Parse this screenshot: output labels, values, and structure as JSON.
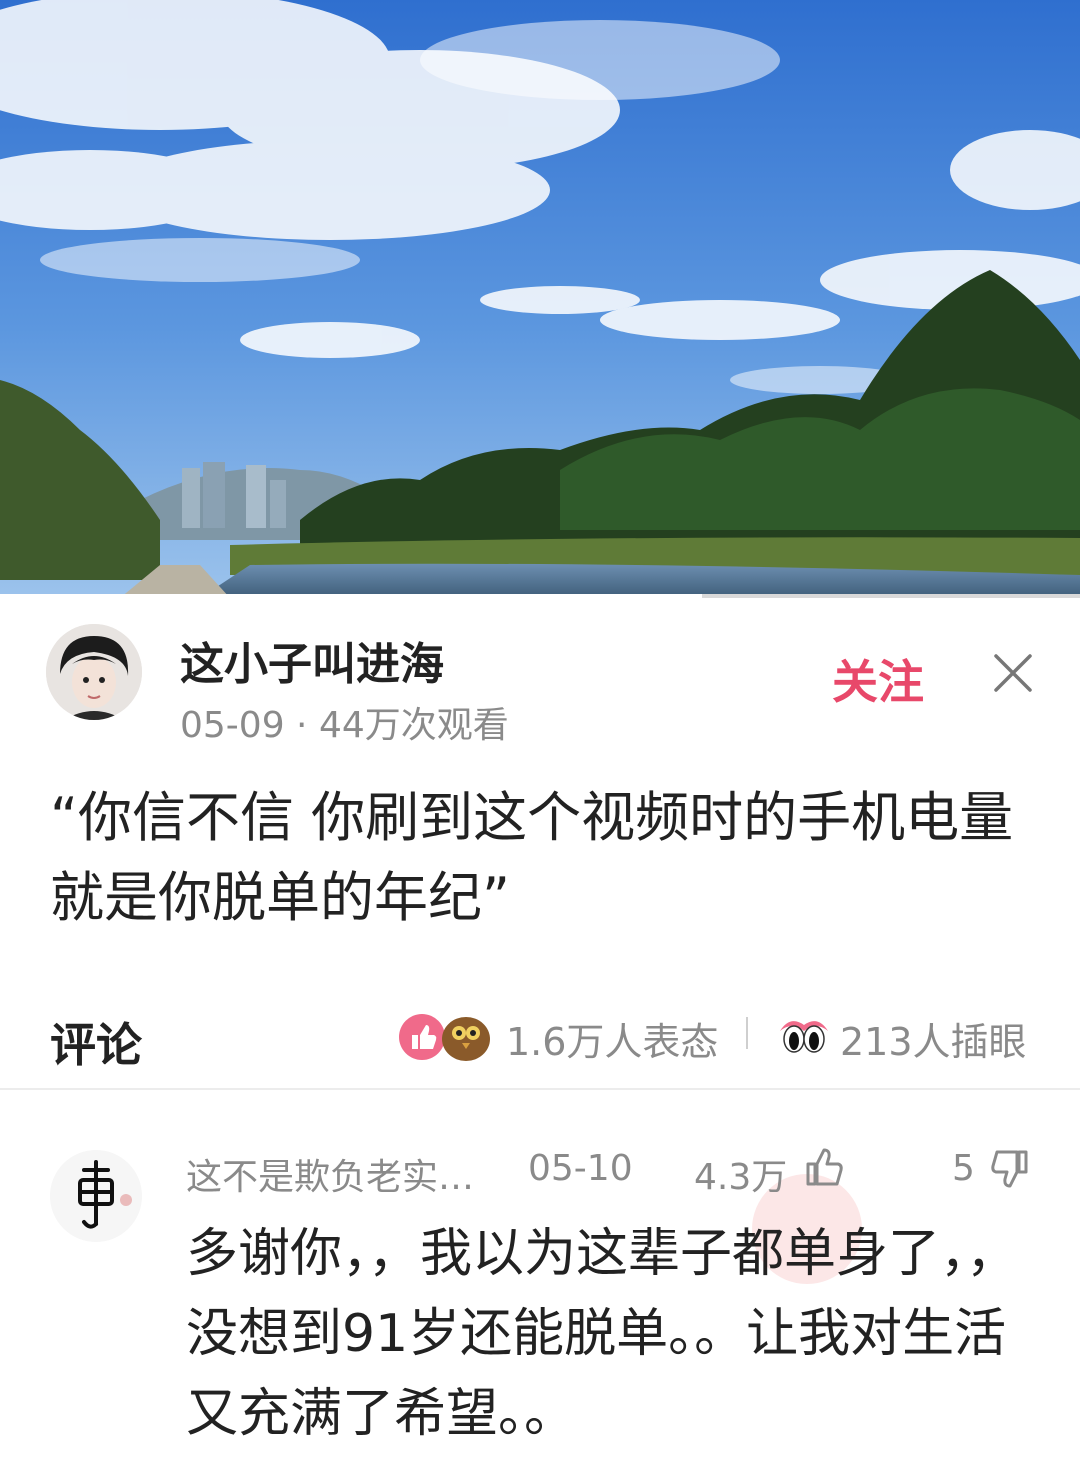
{
  "video": {
    "progress": 0.65
  },
  "author": {
    "name": "这小子叫进海",
    "date": "05-09",
    "views": "44万次观看",
    "meta_sep": " · ",
    "follow_label": "关注"
  },
  "caption": "“你信不信  你刷到这个视频时的手机电量就是你脱单的年纪”",
  "comments_section": {
    "title": "评论",
    "reactions": "1.6万人表态",
    "peeks": "213人插眼"
  },
  "comment": {
    "username": "这不是欺负老实…",
    "date": "05-10",
    "likes": "4.3万",
    "dislikes": "5",
    "text": "多谢你，，我以为这辈子都单身了，，没想到91岁还能脱单。。让我对生活又充满了希望。。"
  },
  "icons": [
    "close-icon",
    "like-icon",
    "dislike-icon",
    "thumbs-up-reaction-icon",
    "owl-reaction-icon",
    "peek-eyes-icon"
  ],
  "colors": {
    "follow": "#e8486a",
    "text": "#222222",
    "muted": "#8a8a8a"
  }
}
